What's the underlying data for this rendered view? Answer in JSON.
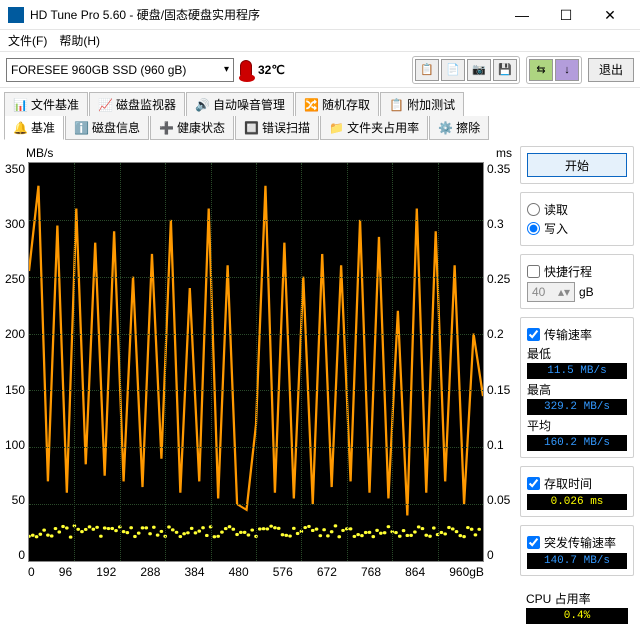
{
  "window": {
    "title": "HD Tune Pro 5.60 - 硬盘/固态硬盘实用程序"
  },
  "menu": {
    "file": "文件(F)",
    "help": "帮助(H)"
  },
  "toolbar": {
    "drive": "FORESEE 960GB SSD (960 gB)",
    "temp": "32℃",
    "exit": "退出"
  },
  "tabs_top": {
    "file_bench": "文件基准",
    "disk_monitor": "磁盘监视器",
    "auto_noise": "自动噪音管理",
    "random_access": "随机存取",
    "extra_test": "附加测试"
  },
  "tabs_bottom": {
    "benchmark": "基准",
    "disk_info": "磁盘信息",
    "health": "健康状态",
    "error_scan": "错误扫描",
    "folder_usage": "文件夹占用率",
    "erase": "擦除"
  },
  "chart": {
    "left_unit": "MB/s",
    "right_unit": "ms",
    "x_unit": "960gB"
  },
  "chart_data": {
    "type": "line",
    "title": "",
    "xlabel": "gB",
    "ylabel_left": "MB/s",
    "ylabel_right": "ms",
    "xlim": [
      0,
      960
    ],
    "ylim_left": [
      0,
      350
    ],
    "ylim_right": [
      0,
      0.35
    ],
    "x_ticks": [
      0,
      96,
      192,
      288,
      384,
      480,
      576,
      672,
      768,
      864
    ],
    "y_ticks_left": [
      0,
      50,
      100,
      150,
      200,
      250,
      300,
      350
    ],
    "y_ticks_right": [
      0,
      0.05,
      0.1,
      0.15,
      0.2,
      0.25,
      0.3,
      0.35
    ],
    "series": [
      {
        "name": "transfer_rate",
        "unit": "MB/s",
        "color": "#ff9900",
        "x": [
          0,
          20,
          40,
          60,
          80,
          100,
          120,
          140,
          160,
          180,
          200,
          220,
          240,
          260,
          280,
          300,
          320,
          340,
          360,
          380,
          400,
          420,
          440,
          460,
          480,
          500,
          520,
          540,
          560,
          580,
          600,
          620,
          640,
          660,
          680,
          700,
          720,
          740,
          760,
          780,
          800,
          820,
          840,
          860,
          880,
          900,
          920,
          940,
          960
        ],
        "values": [
          255,
          330,
          70,
          295,
          60,
          310,
          85,
          280,
          75,
          290,
          70,
          250,
          65,
          270,
          90,
          300,
          60,
          240,
          70,
          310,
          55,
          260,
          50,
          45,
          120,
          330,
          60,
          280,
          55,
          250,
          50,
          270,
          65,
          260,
          70,
          300,
          60,
          285,
          55,
          220,
          40,
          310,
          60,
          290,
          70,
          260,
          50,
          200,
          145
        ]
      },
      {
        "name": "access_time",
        "unit": "ms",
        "color": "#ffff33",
        "approx_constant": 0.026
      }
    ]
  },
  "side": {
    "start": "开始",
    "mode_group": {
      "read": "读取",
      "write": "写入",
      "selected": "write"
    },
    "quick": "快捷行程",
    "block_size": {
      "value": "40",
      "unit": "gB"
    },
    "transfer_rate": {
      "title": "传输速率",
      "min_label": "最低",
      "min": "11.5 MB/s",
      "max_label": "最高",
      "max": "329.2 MB/s",
      "avg_label": "平均",
      "avg": "160.2 MB/s"
    },
    "access_time": {
      "title": "存取时间",
      "value": "0.026 ms"
    },
    "burst_rate": {
      "title": "突发传输速率",
      "value": "140.7 MB/s"
    },
    "cpu": {
      "title": "CPU 占用率",
      "value": "0.4%"
    }
  }
}
